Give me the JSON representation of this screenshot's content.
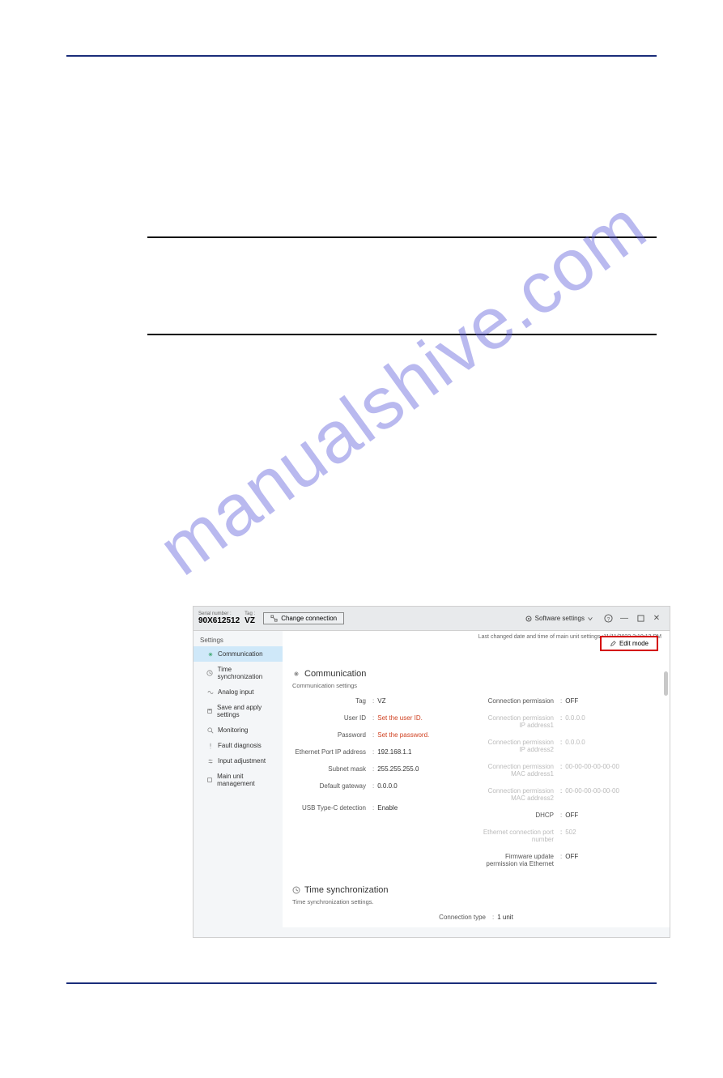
{
  "watermark": "manualshive.com",
  "titlebar": {
    "serial_label": "Serial number :",
    "serial_value": "90X612512",
    "tag_label": "Tag :",
    "tag_value": "VZ",
    "change_connection": "Change connection",
    "software_settings": "Software settings",
    "help": "?",
    "minimize": "—",
    "maximize": "▢",
    "close": "✕"
  },
  "last_changed": "Last changed date and time of main unit settings :11/11/2022 3:10:13 PM",
  "edit_mode": "Edit mode",
  "sidebar": {
    "header": "Settings",
    "items": [
      {
        "label": "Communication"
      },
      {
        "label": "Time synchronization"
      },
      {
        "label": "Analog input"
      },
      {
        "label": "Save and apply settings"
      },
      {
        "label": "Monitoring"
      },
      {
        "label": "Fault diagnosis"
      },
      {
        "label": "Input adjustment"
      },
      {
        "label": "Main unit management"
      }
    ]
  },
  "main": {
    "comm_title": "Communication",
    "comm_sub": "Communication settings",
    "left": [
      {
        "label": "Tag",
        "value": "VZ"
      },
      {
        "label": "User ID",
        "value": "Set the user ID.",
        "red": true
      },
      {
        "label": "Password",
        "value": "Set the password.",
        "red": true
      },
      {
        "label": "Ethernet Port IP address",
        "value": "192.168.1.1"
      },
      {
        "label": "Subnet mask",
        "value": "255.255.255.0"
      },
      {
        "label": "Default gateway",
        "value": "0.0.0.0"
      },
      {
        "label": "USB Type-C detection",
        "value": "Enable"
      }
    ],
    "right": [
      {
        "label": "Connection permission",
        "value": "OFF"
      },
      {
        "label": "Connection permission IP address1",
        "value": "0.0.0.0",
        "muted": true
      },
      {
        "label": "Connection permission IP address2",
        "value": "0.0.0.0",
        "muted": true
      },
      {
        "label": "Connection permission MAC address1",
        "value": "00-00-00-00-00-00",
        "muted": true
      },
      {
        "label": "Connection permission MAC address2",
        "value": "00-00-00-00-00-00",
        "muted": true
      },
      {
        "label": "DHCP",
        "value": "OFF"
      },
      {
        "label": "Ethernet connection port number",
        "value": "502",
        "muted": true
      },
      {
        "label": "Firmware update permission via Ethernet",
        "value": "OFF"
      }
    ],
    "time_title": "Time synchronization",
    "time_sub": "Time synchronization settings.",
    "time_row": {
      "label": "Connection type",
      "value": "1 unit"
    }
  }
}
